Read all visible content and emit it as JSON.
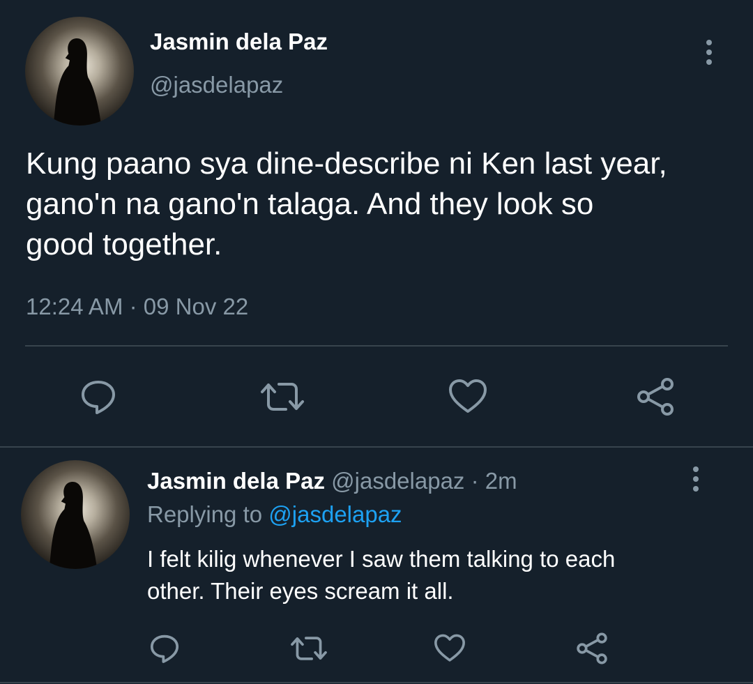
{
  "main_tweet": {
    "author_name": "Jasmin dela Paz",
    "author_handle": "@jasdelapaz",
    "text_lines": [
      "Kung paano sya dine-describe ni Ken last year,",
      "gano'n na gano'n talaga. And they look so",
      "good together."
    ],
    "time": "12:24 AM",
    "separator": "·",
    "date": "09 Nov 22",
    "actions": [
      "reply-icon",
      "retweet-icon",
      "like-icon",
      "share-icon"
    ]
  },
  "reply_tweet": {
    "author_name": "Jasmin dela Paz",
    "author_handle": "@jasdelapaz",
    "separator": "·",
    "age": "2m",
    "replying_to_label": "Replying to",
    "replying_to_handle": "@jasdelapaz",
    "text_lines": [
      "I felt kilig whenever I saw them talking to each",
      "other. Their eyes scream it all."
    ],
    "actions": [
      "reply-icon",
      "retweet-icon",
      "like-icon",
      "share-icon"
    ]
  },
  "colors": {
    "background": "#15202b",
    "text": "#ffffff",
    "muted": "#8899a6",
    "link": "#1da1f2",
    "divider": "#38444d"
  }
}
